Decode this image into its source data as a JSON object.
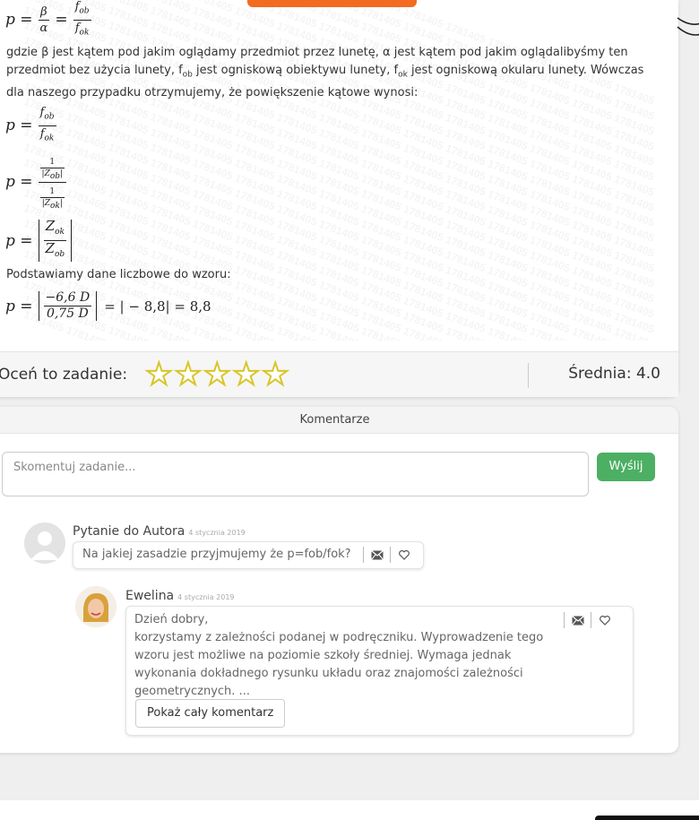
{
  "solution": {
    "paragraph1": "gdzie β jest kątem pod jakim oglądamy przedmiot przez lunetę, α jest kątem pod jakim oglądalibyśmy ten przedmiot bez użycia lunety, f",
    "paragraph1_line1": "gdzie β jest kątem pod jakim oglądamy przedmiot przez lunetę, α jest kątem pod jakim oglądalibyśmy ten",
    "paragraph1_line2_a": "przedmiot bez użycia lunety, f",
    "paragraph1_sub1": "ob",
    "paragraph1_line2_b": " jest ogniskową obiektywu lunety, f",
    "paragraph1_sub2": "ok",
    "paragraph1_line2_c": " jest ogniskową okularu lunety. Wówczas",
    "paragraph1_line3": "dla naszego przypadku otrzymujemy, że powiększenie kątowe wynosi:",
    "paragraph2": "Podstawiamy dane liczbowe do wzoru:",
    "eq_p": "p =",
    "eq0_num1": "β",
    "eq0_den1": "α",
    "eq0_num2": "fob",
    "eq0_den2": "fok",
    "eq1_num": "fob",
    "eq1_den": "fok",
    "eq2_num": "|Zob|",
    "eq2_den": "|Zok|",
    "eq3_num": "Zok",
    "eq3_den": "Zob",
    "eq4_num": "−6,6  D",
    "eq4_den": "0,75  D",
    "eq4_tail": "= | − 8,8| = 8,8",
    "watermark": "1781405"
  },
  "rating": {
    "label": "Oceń to zadanie:",
    "stars": 5,
    "average_label": "Średnia: 4.0"
  },
  "comments": {
    "header": "Komentarze",
    "input_placeholder": "Skomentuj zadanie...",
    "send_label": "Wyślij",
    "items": [
      {
        "author": "Pytanie do Autora",
        "date": "4 stycznia 2019",
        "text": "Na jakiej zasadzie przyjmujemy że p=fob/fok?"
      },
      {
        "author": "Ewelina",
        "date": "4 stycznia 2019",
        "text_lines": [
          "Dzień dobry,",
          "korzystamy z zależności podanej w podręczniku. Wyprowadzenie tego",
          "wzoru jest możliwe na poziomie szkoły średniej. Wymaga jednak",
          "wykonania dokładnego rysunku układu oraz znajomości zależności",
          "geometrycznych. ..."
        ],
        "show_more_label": "Pokaż cały komentarz"
      }
    ]
  },
  "colors": {
    "accent_orange": "#f26b21",
    "send_green": "#4caf63",
    "star_outline": "#d8c62a"
  }
}
